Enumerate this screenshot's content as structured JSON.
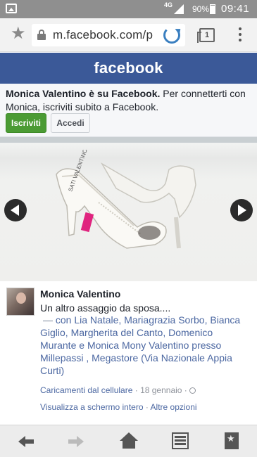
{
  "status_bar": {
    "network": "4G",
    "battery_percent": "90%",
    "time": "09:41"
  },
  "browser": {
    "url": "m.facebook.com/p",
    "tab_count": "1"
  },
  "header": {
    "logo_text": "facebook"
  },
  "promo": {
    "bold_text": "Monica Valentino è su Facebook.",
    "text": " Per connetterti con Monica, iscriviti subito a Facebook.",
    "signup_label": "Iscriviti",
    "login_label": "Accedi"
  },
  "photo": {
    "brand_text": "SATI VALENTINO"
  },
  "post": {
    "author": "Monica Valentino",
    "message": "Un altro assaggio da sposa....",
    "with_dash": "—",
    "with_word": " con ",
    "tagged": [
      "Lia Natale",
      "Mariagrazia Sorbo",
      "Bianca Giglio",
      "Margherita del Canto",
      "Domenico Murante",
      "Monica Mony Valentino"
    ],
    "sep_comma": ", ",
    "and_word": " e ",
    "at_word": " presso ",
    "place": "Millepassi , Megastore (Via Nazionale Appia Curti)",
    "meta_link": "Caricamenti dal cellulare",
    "meta_dot": " · ",
    "date": "18 gennaio",
    "action_full_screen": "Visualizza a schermo intero",
    "action_sep": " · ",
    "action_more": "Altre opzioni"
  }
}
